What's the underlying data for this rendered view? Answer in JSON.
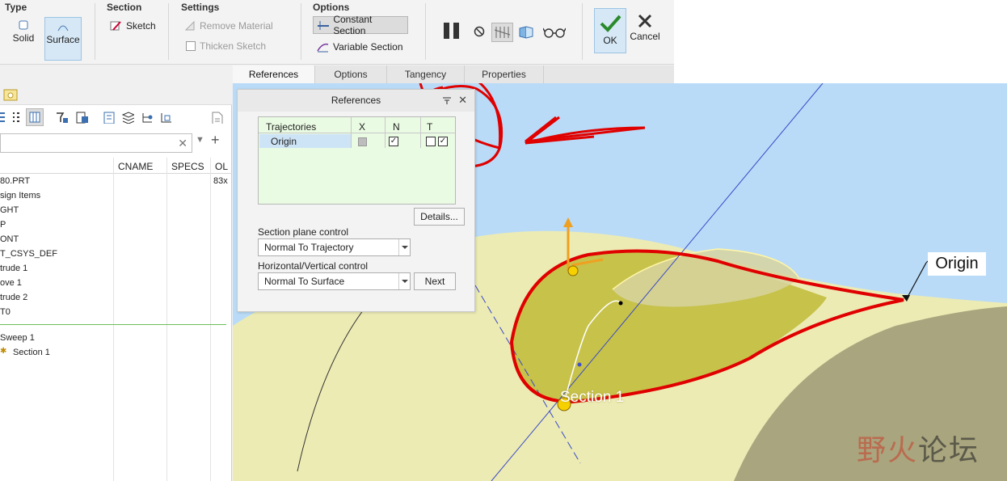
{
  "ribbon": {
    "groups": {
      "type": "Type",
      "section": "Section",
      "settings": "Settings",
      "options": "Options"
    },
    "type": {
      "solid": "Solid",
      "surface": "Surface"
    },
    "section": {
      "sketch": "Sketch"
    },
    "settings": {
      "remove_material": "Remove Material",
      "thicken_sketch": "Thicken Sketch"
    },
    "options": {
      "constant_section": "Constant Section",
      "variable_section": "Variable Section"
    },
    "ok": "OK",
    "cancel": "Cancel"
  },
  "tabs": [
    "References",
    "Options",
    "Tangency",
    "Properties"
  ],
  "model_tree": {
    "columns": {
      "cname": "CNAME",
      "specs": "SPECS",
      "ol": "OL"
    },
    "row0_value": "83x",
    "items": [
      "80.PRT",
      "sign Items",
      "GHT",
      "P",
      "ONT",
      "T_CSYS_DEF",
      "trude 1",
      "ove 1",
      "trude 2",
      "T0",
      "Sweep 1",
      "Section 1"
    ]
  },
  "dialog": {
    "title": "References",
    "table": {
      "h_traj": "Trajectories",
      "h_x": "X",
      "h_n": "N",
      "h_t": "T",
      "row_name": "Origin"
    },
    "details": "Details...",
    "section_plane_label": "Section plane control",
    "section_plane_value": "Normal To Trajectory",
    "hv_label": "Horizontal/Vertical control",
    "hv_value": "Normal To Surface",
    "next": "Next"
  },
  "viewport": {
    "origin_callout": "Origin",
    "section_label": "Section 1",
    "watermark_a": "野火",
    "watermark_b": "论坛"
  },
  "colors": {
    "accent": "#e00000",
    "select_bg": "#d6e8f6",
    "viewport_bg": "#b9dbf7",
    "table_bg": "#eafbe3"
  }
}
